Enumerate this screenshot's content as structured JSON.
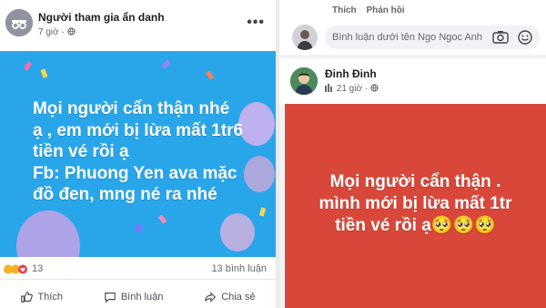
{
  "left_post": {
    "author": "Người tham gia ẩn danh",
    "time": "7 giờ",
    "body_lines": [
      "Mọi người cẩn thận nhé",
      "ạ , em mới bị lừa mất 1tr6",
      "tiền vé rồi ạ",
      "Fb: Phuong Yen ava mặc",
      "đồ đen, mng né ra nhé"
    ],
    "reaction_count": "13",
    "comment_count": "13 bình luận",
    "actions": {
      "like": "Thích",
      "comment": "Bình luận",
      "share": "Chia sẻ"
    },
    "colors": {
      "background": "#29a6ea",
      "text": "#ffffff"
    }
  },
  "right_post": {
    "top_links": {
      "like": "Thích",
      "reply": "Phản hồi"
    },
    "comment_placeholder": "Bình luận dưới tên Ngo Ngoc Anh",
    "author": "Đinh Đinh",
    "time": "21 giờ",
    "body_lines": [
      "Mọi người cẩn thận .",
      "mình mới bị lừa mất 1tr",
      "tiền vé rồi ạ🥺🥺🥺"
    ],
    "colors": {
      "background": "#d8473a",
      "text": "#ffffff"
    }
  },
  "icons": [
    "more-options-icon",
    "globe-icon",
    "like-icon",
    "comment-icon",
    "share-icon",
    "camera-icon",
    "smiley-icon"
  ]
}
